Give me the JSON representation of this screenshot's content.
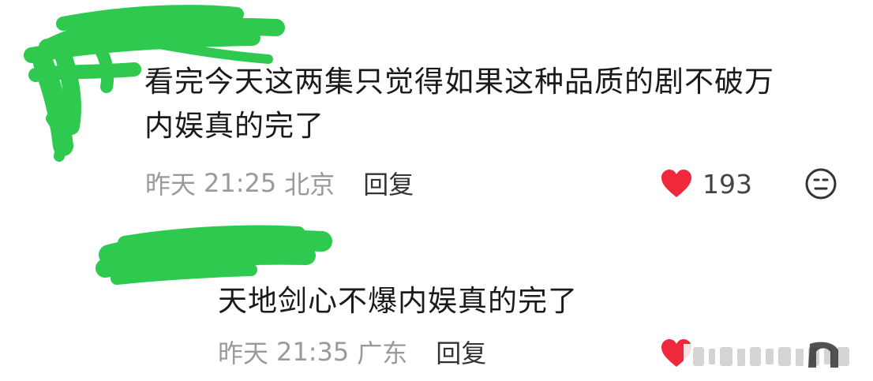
{
  "comments": [
    {
      "text_line1": "看完今天这两集只觉得如果这种品质的剧不破万",
      "text_line2": "内娱真的完了",
      "day": "昨天",
      "time": "21:25",
      "location": "北京",
      "reply_label": "回复",
      "likes": "193"
    },
    {
      "text_line1": "天地剑心不爆内娱真的完了",
      "day": "昨天",
      "time": "21:35",
      "location": "广东",
      "reply_label": "回复"
    }
  ],
  "colors": {
    "redaction_green": "#2fc94f",
    "heart_red": "#f0283c"
  },
  "icons": {
    "like": "heart-icon",
    "more": "face-icon"
  }
}
